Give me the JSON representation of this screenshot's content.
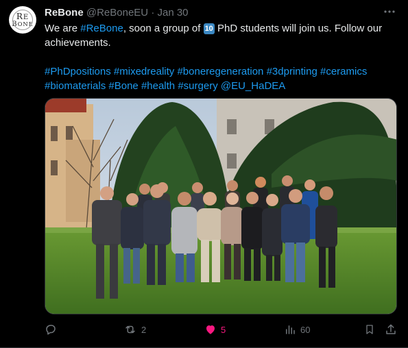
{
  "author": {
    "avatar_text_top": "ReBone",
    "name": "ReBone",
    "handle": "@ReBoneEU",
    "separator": "·",
    "date": "Jan 30"
  },
  "tweet": {
    "text_1": "We are ",
    "mention_rebone": "#ReBone",
    "text_2": ", soon a group of ",
    "emoji_ten": "10",
    "text_3": " PhD students will join us. Follow our achievements.",
    "hashtags_line1": [
      "#PhDpositions",
      "#mixedreality",
      "#boneregeneration",
      "#3dprinting",
      "#ceramics"
    ],
    "hashtags_line2": [
      "#biomaterials",
      "#Bone",
      "#health",
      "#surgery",
      "@EU_HaDEA"
    ]
  },
  "actions": {
    "reply_count": "",
    "retweet_count": "2",
    "like_count": "5",
    "views_count": "60"
  },
  "colors": {
    "accent": "#1d9bf0",
    "like": "#f91880",
    "muted": "#71767b"
  }
}
